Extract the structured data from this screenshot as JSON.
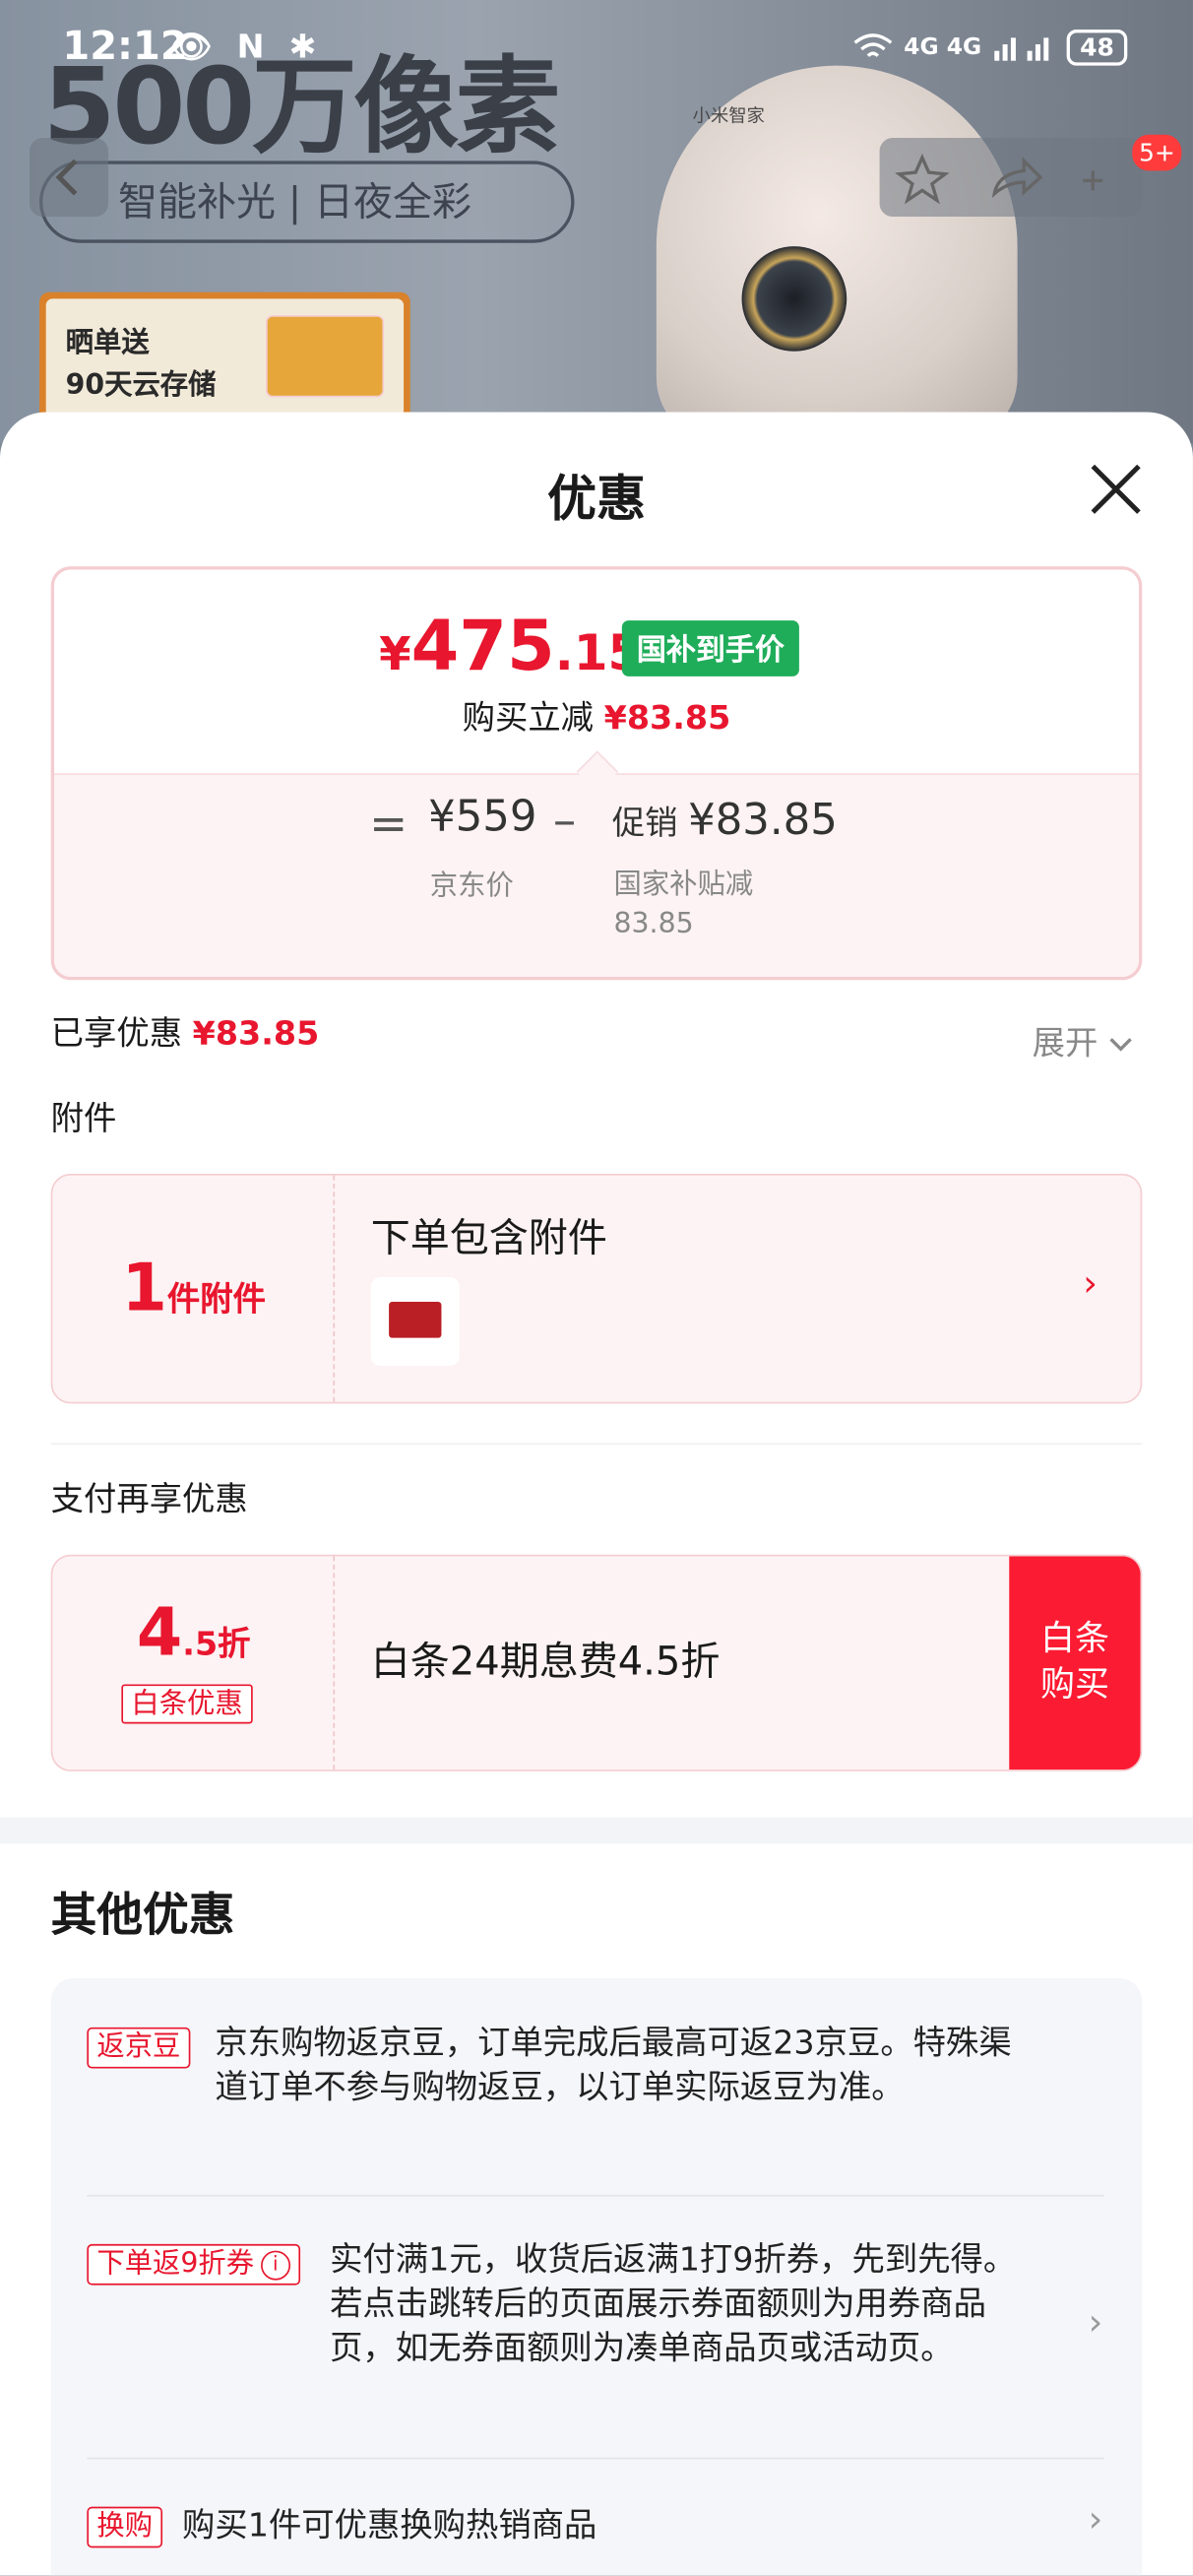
{
  "background": {
    "headline": "500万像素",
    "pill": "智能补光 | 日夜全彩",
    "promo_line1": "晒单送",
    "promo_line2": "90天云存储",
    "camera_brand": "小米智家",
    "cart_badge": "5+"
  },
  "status_bar": {
    "time": "12:12",
    "left_icons": "👁 N ✱",
    "signal": "4G 4G",
    "battery": "48"
  },
  "sheet": {
    "title": "优惠",
    "price_symbol": "¥",
    "price_int": "475",
    "price_dec": ".15",
    "price_tag": "国补到手价",
    "reduce_label": "购买立减",
    "reduce_value": "¥83.85",
    "eq": "=",
    "jd_price": "¥559",
    "jd_label": "京东价",
    "minus": "–",
    "promo_label": "促销",
    "promo_value": "¥83.85",
    "subsidy_label": "国家补贴减",
    "subsidy_value": "83.85",
    "enjoyed_label": "已享优惠",
    "enjoyed_value": "¥83.85",
    "expand_label": "展开"
  },
  "accessory": {
    "section_title": "附件",
    "count": "1",
    "count_unit": "件附件",
    "title": "下单包含附件"
  },
  "payment": {
    "section_title": "支付再享优惠",
    "discount_num": "4",
    "discount_unit": ".5折",
    "discount_tag": "白条优惠",
    "text": "白条24期息费4.5折",
    "button": "白条\n购买"
  },
  "other": {
    "title": "其他优惠",
    "items": [
      {
        "tag": "返京豆",
        "text": "京东购物返京豆，订单完成后最高可返23京豆。特殊渠道订单不参与购物返豆，以订单实际返豆为准。"
      },
      {
        "tag": "下单返9折券",
        "text": "实付满1元，收货后返满1打9折券，先到先得。若点击跳转后的页面展示券面额则为用券商品页，如无券面额则为凑单商品页或活动页。"
      },
      {
        "tag": "换购",
        "text": "购买1件可优惠换购热销商品"
      }
    ]
  }
}
